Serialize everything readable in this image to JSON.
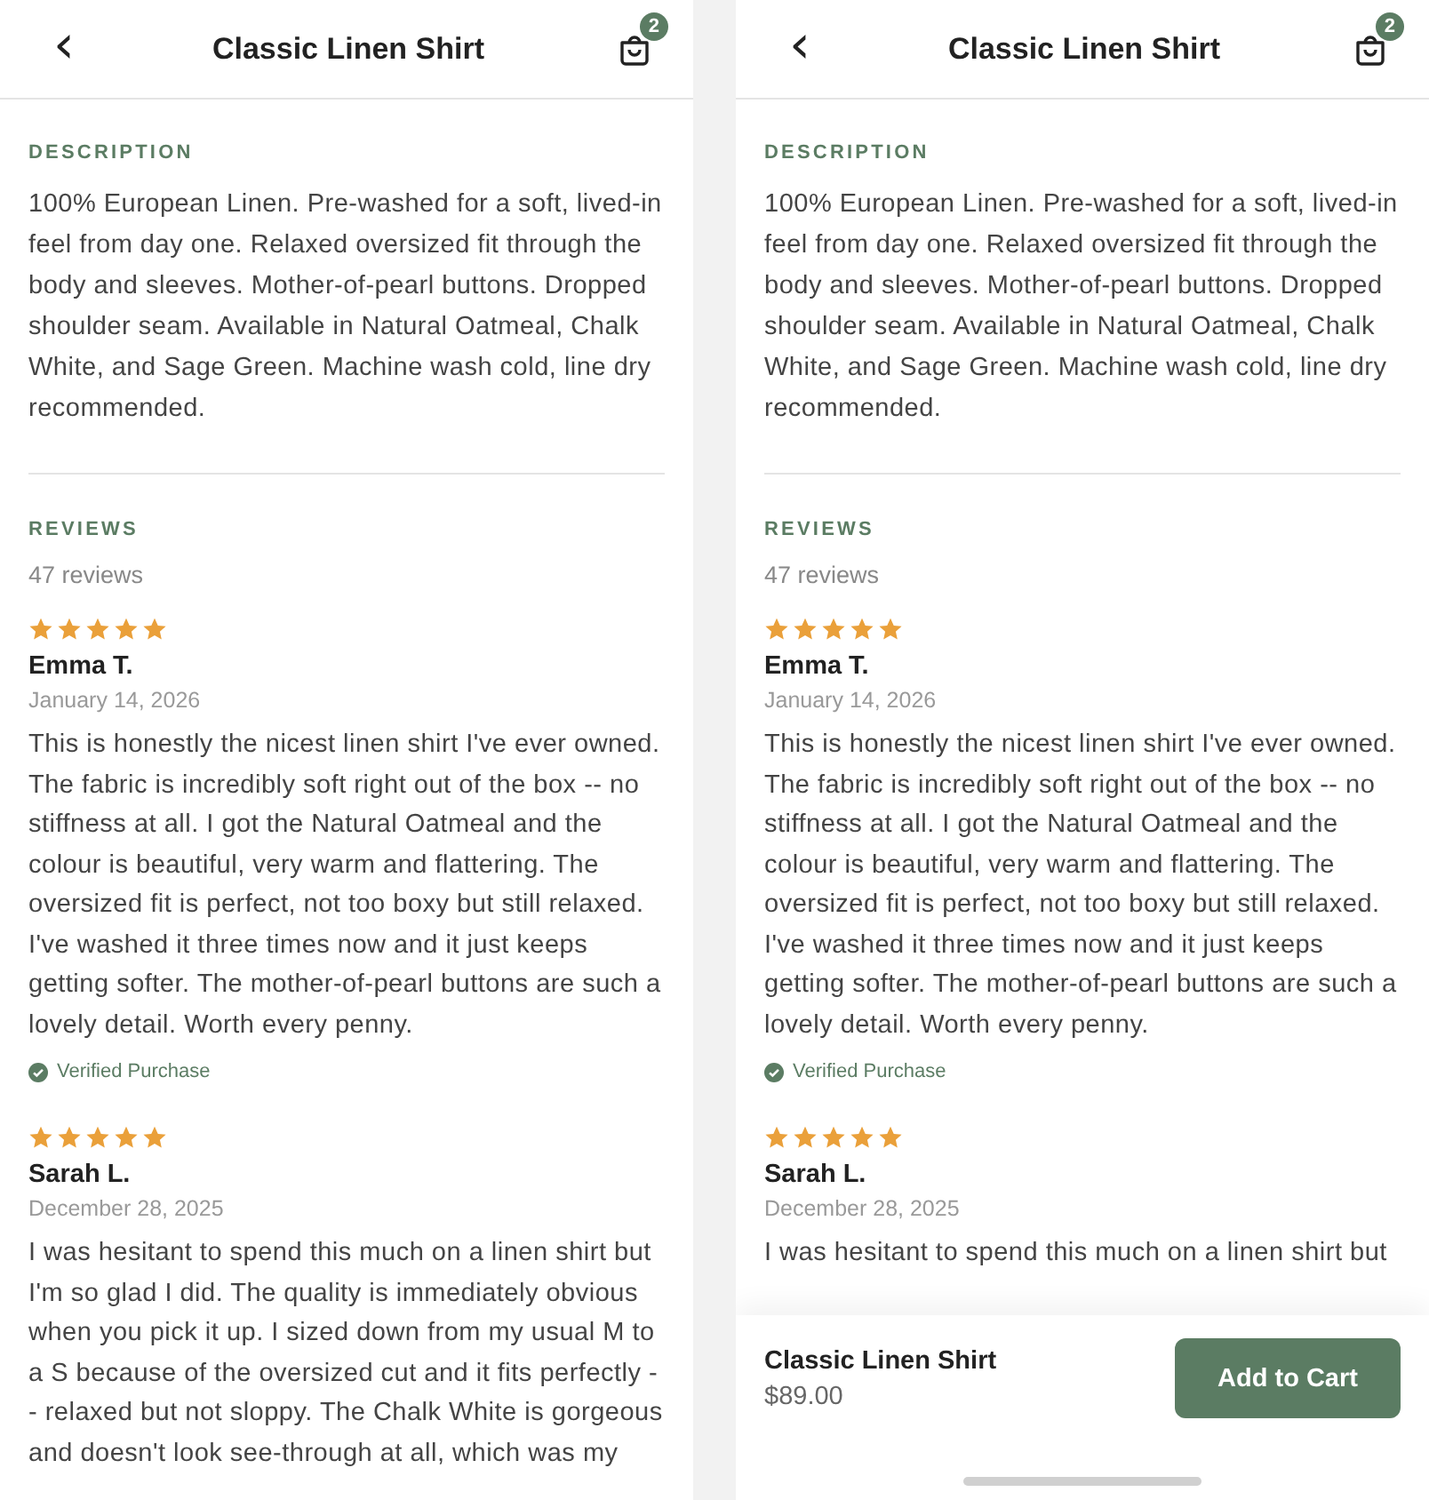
{
  "screens": [
    {
      "header": {
        "back": "‹",
        "title": "Classic Linen Shirt",
        "cart_count": "2"
      },
      "description": {
        "heading": "DESCRIPTION",
        "text": "100% European Linen. Pre-washed for a soft, lived-in feel from day one. Relaxed oversized fit through the body and sleeves. Mother-of-pearl buttons. Dropped shoulder seam. Available in Natural Oatmeal, Chalk White, and Sage Green. Machine wash cold, line dry recommended."
      },
      "reviews": {
        "heading": "REVIEWS",
        "count": "47 reviews",
        "items": [
          {
            "stars": 5,
            "name": "Emma T.",
            "date": "January 14, 2026",
            "text": "This is honestly the nicest linen shirt I've ever owned. The fabric is incredibly soft right out of the box -- no stiffness at all. I got the Natural Oatmeal and the colour is beautiful, very warm and flattering. The oversized fit is perfect, not too boxy but still relaxed. I've washed it three times now and it just keeps getting softer. The mother-of-pearl buttons are such a lovely detail. Worth every penny.",
            "verified": true,
            "badge": "Verified Purchase"
          },
          {
            "stars": 5,
            "name": "Sarah L.",
            "date": "December 28, 2025",
            "text": "I was hesitant to spend this much on a linen shirt but I'm so glad I did. The quality is immediately obvious when you pick it up. I sized down from my usual M to a S because of the oversized cut and it fits perfectly -- relaxed but not sloppy. The Chalk White is gorgeous and doesn't look see-through at all, which was my"
          }
        ]
      }
    },
    {
      "header": {
        "back": "‹",
        "title": "Classic Linen Shirt",
        "cart_count": "2"
      },
      "description": {
        "heading": "DESCRIPTION",
        "text": "100% European Linen. Pre-washed for a soft, lived-in feel from day one. Relaxed oversized fit through the body and sleeves. Mother-of-pearl buttons. Dropped shoulder seam. Available in Natural Oatmeal, Chalk White, and Sage Green. Machine wash cold, line dry recommended."
      },
      "reviews": {
        "heading": "REVIEWS",
        "count": "47 reviews",
        "items": [
          {
            "stars": 5,
            "name": "Emma T.",
            "date": "January 14, 2026",
            "text": "This is honestly the nicest linen shirt I've ever owned. The fabric is incredibly soft right out of the box -- no stiffness at all. I got the Natural Oatmeal and the colour is beautiful, very warm and flattering. The oversized fit is perfect, not too boxy but still relaxed. I've washed it three times now and it just keeps getting softer. The mother-of-pearl buttons are such a lovely detail. Worth every penny.",
            "verified": true,
            "badge": "Verified Purchase"
          },
          {
            "stars": 5,
            "name": "Sarah L.",
            "date": "December 28, 2025",
            "text": "I was hesitant to spend this much on a linen shirt but"
          }
        ]
      },
      "bottom_bar": {
        "product": "Classic Linen Shirt",
        "price": "$89.00",
        "button": "Add to Cart"
      }
    }
  ]
}
